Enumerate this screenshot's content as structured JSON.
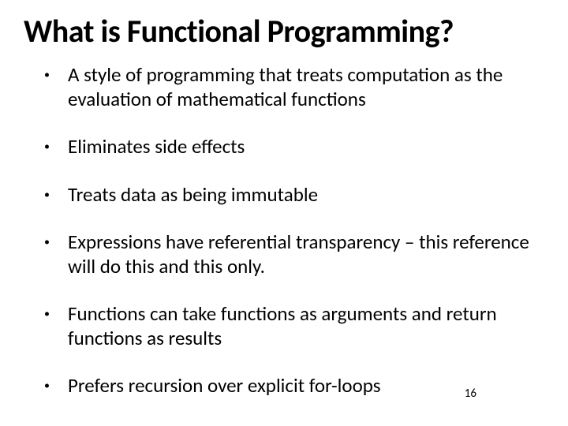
{
  "slide": {
    "title": "What is Functional Programming?",
    "bullets": [
      "A style of programming that treats computation as the evaluation of mathematical functions",
      "Eliminates side effects",
      "Treats data as being immutable",
      "Expressions have referential transparency – this reference will do this and this only.",
      "Functions can take functions as arguments and return functions as results",
      "Prefers recursion over explicit for-loops"
    ],
    "page_number": "16"
  }
}
